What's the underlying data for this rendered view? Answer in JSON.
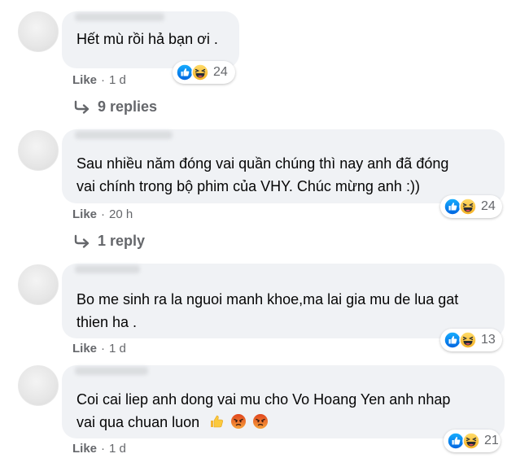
{
  "colors": {
    "bubble": "#f0f2f5",
    "meta": "#65676b",
    "like_blue": "#1877f2",
    "haha_yellow": "#f7b928"
  },
  "comments": [
    {
      "text_lines": [
        "Hết mù rồi hả bạn ơi ."
      ],
      "like_label": "Like",
      "time": "1 d",
      "reactions": [
        "like-icon",
        "haha-icon"
      ],
      "reaction_count": "24",
      "replies_label": "9 replies"
    },
    {
      "text_lines": [
        "Sau nhiều năm đóng vai quần chúng thì nay anh đã đóng",
        "vai chính trong bộ phim của VHY. Chúc mừng anh :))"
      ],
      "like_label": "Like",
      "time": "20 h",
      "reactions": [
        "like-icon",
        "haha-icon"
      ],
      "reaction_count": "24",
      "replies_label": "1 reply"
    },
    {
      "text_lines": [
        "Bo me sinh ra la nguoi manh khoe,ma lai gia mu de lua gat",
        "thien ha ."
      ],
      "like_label": "Like",
      "time": "1 d",
      "reactions": [
        "like-icon",
        "haha-icon"
      ],
      "reaction_count": "13"
    },
    {
      "text_lines": [
        "Coi cai liep anh dong vai mu cho Vo Hoang Yen anh nhap",
        "vai qua chuan luon"
      ],
      "inline_emojis": [
        "thumbs-up-emoji",
        "angry-face-emoji",
        "angry-face-emoji"
      ],
      "like_label": "Like",
      "time": "1 d",
      "reactions": [
        "like-icon",
        "haha-icon"
      ],
      "reaction_count": "21"
    }
  ],
  "separator": "·"
}
